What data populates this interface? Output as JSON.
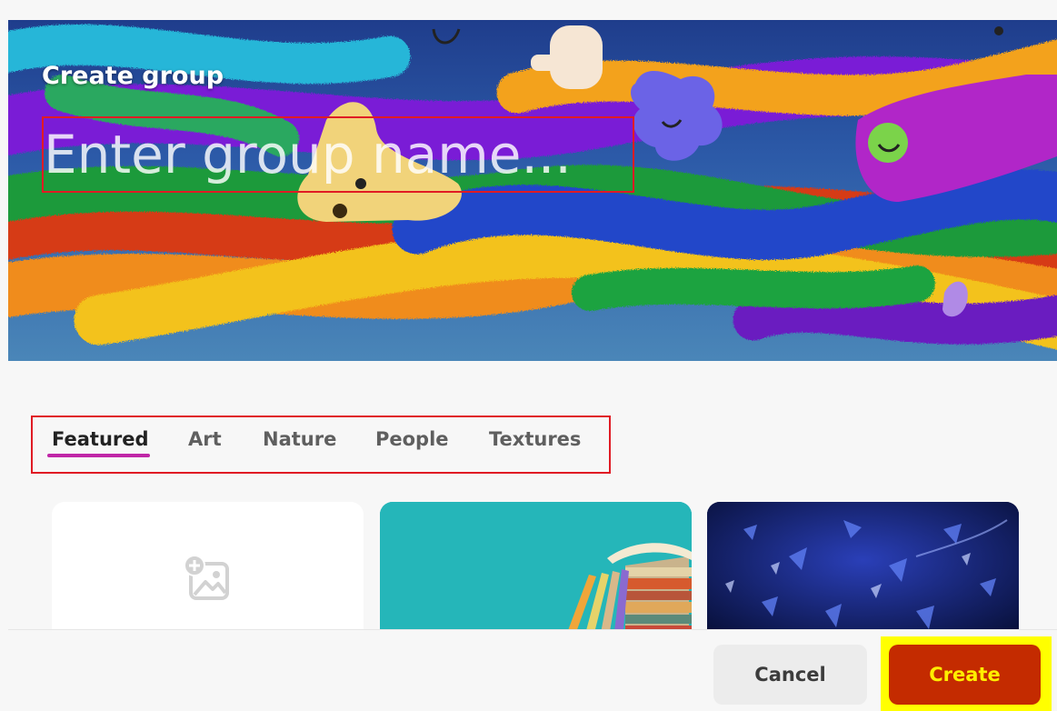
{
  "dialog": {
    "title": "Create group",
    "name_placeholder": "Enter group name...",
    "name_value": ""
  },
  "tabs": [
    {
      "label": "Featured",
      "active": true
    },
    {
      "label": "Art",
      "active": false
    },
    {
      "label": "Nature",
      "active": false
    },
    {
      "label": "People",
      "active": false
    },
    {
      "label": "Textures",
      "active": false
    }
  ],
  "cards": [
    {
      "kind": "upload",
      "icon": "add-image-icon"
    },
    {
      "kind": "image",
      "subject": "books-and-pencils"
    },
    {
      "kind": "image",
      "subject": "blue-crystals"
    }
  ],
  "footer": {
    "cancel_label": "Cancel",
    "create_label": "Create"
  },
  "colors": {
    "tab_underline": "#c026a7",
    "create_button": "#c42b00",
    "create_text": "#ffee00",
    "highlight": "#ffff00",
    "annotation_box": "#e01b24"
  }
}
